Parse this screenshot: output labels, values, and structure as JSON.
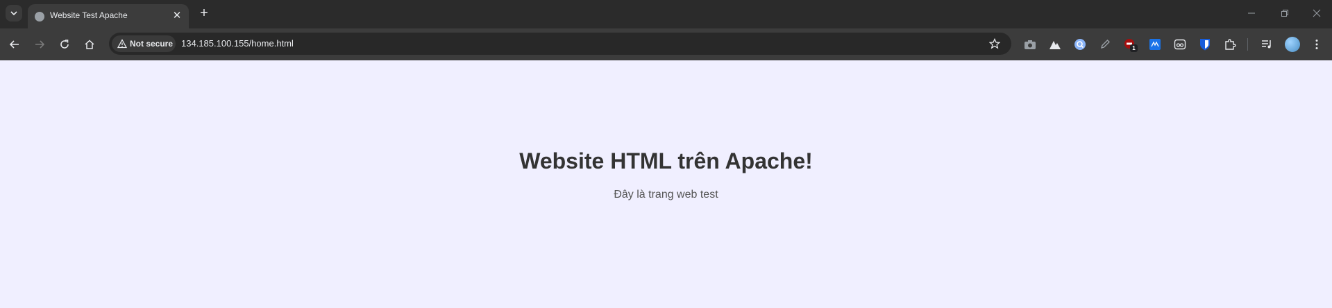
{
  "tab": {
    "title": "Website Test Apache",
    "close_glyph": "✕",
    "new_tab_glyph": "+"
  },
  "toolbar": {
    "security_label": "Not secure",
    "url": "134.185.100.155/home.html"
  },
  "extensions": {
    "badge_count": "1"
  },
  "page": {
    "heading": "Website HTML trên Apache!",
    "subtitle": "Đây là trang web test"
  },
  "colors": {
    "page_background": "#f0efff",
    "heading": "#333333",
    "subtitle": "#555555",
    "chrome_dark": "#202124"
  }
}
